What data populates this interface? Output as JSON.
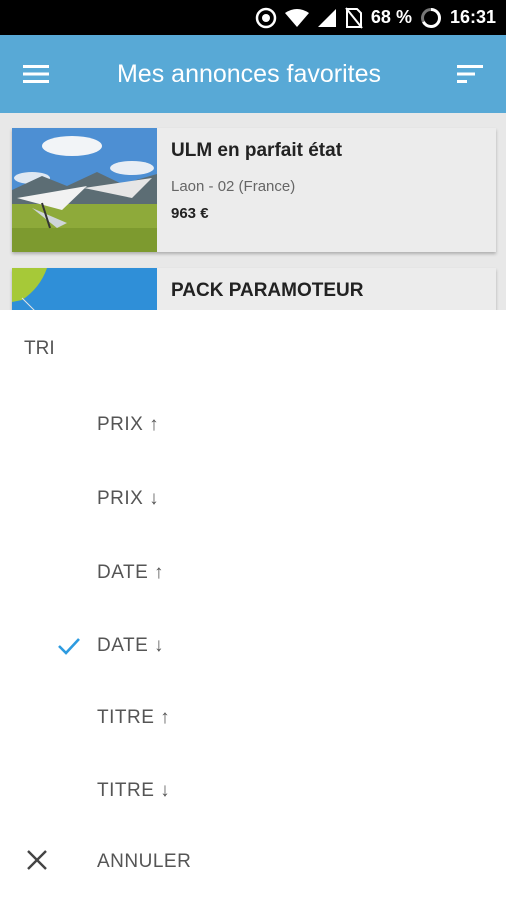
{
  "status_bar": {
    "battery": "68 %",
    "time": "16:31"
  },
  "app_bar": {
    "title": "Mes annonces favorites",
    "menu_icon": "hamburger-menu-icon",
    "sort_icon": "sort-icon"
  },
  "listings": [
    {
      "title": "ULM en parfait état",
      "location": "Laon - 02 (France)",
      "price": "963 €"
    },
    {
      "title": "PACK PARAMOTEUR"
    }
  ],
  "sort_sheet": {
    "title": "TRI",
    "options": [
      {
        "label": "PRIX ↑",
        "selected": false
      },
      {
        "label": "PRIX ↓",
        "selected": false
      },
      {
        "label": "DATE ↑",
        "selected": false
      },
      {
        "label": "DATE ↓",
        "selected": true
      },
      {
        "label": "TITRE ↑",
        "selected": false
      },
      {
        "label": "TITRE ↓",
        "selected": false
      }
    ],
    "cancel_label": "ANNULER",
    "accent_color": "#2d9be0"
  }
}
